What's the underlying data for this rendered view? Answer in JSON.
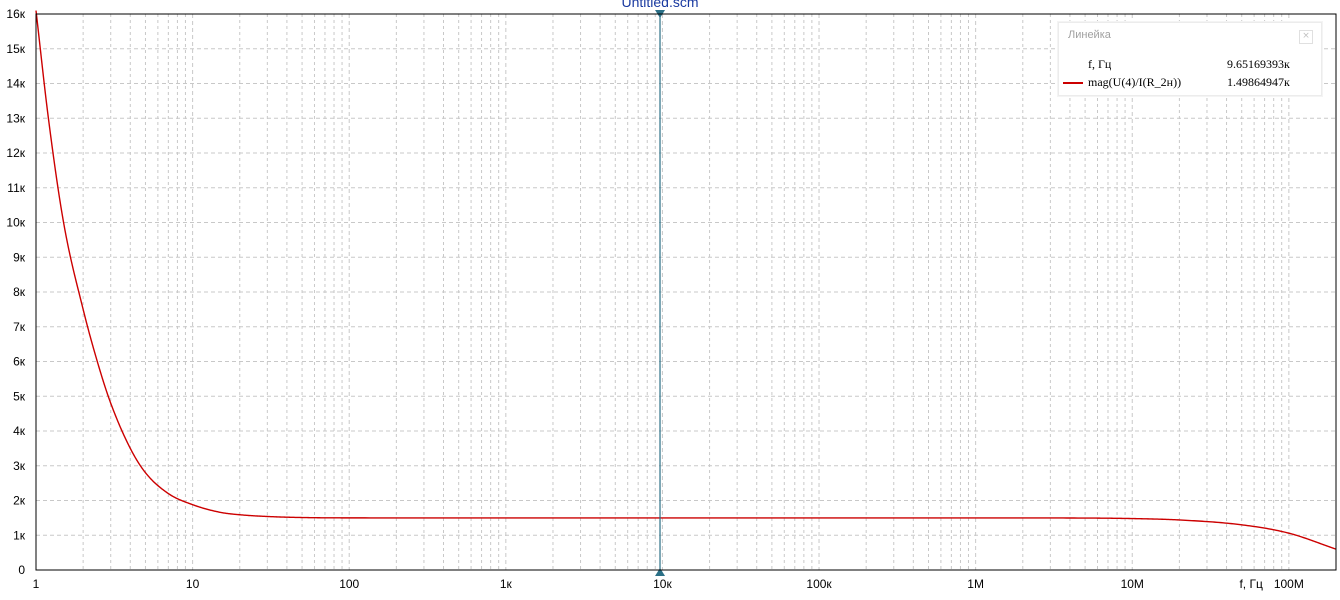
{
  "window": {
    "title": "Untitled.scm"
  },
  "colors": {
    "curve": "#cc0000",
    "cursor": "#2a6f86",
    "grid": "#c8c8c8",
    "title": "#1a3aa0"
  },
  "chart_data": {
    "type": "line",
    "x_scale": "log",
    "xlim": [
      1,
      200000000
    ],
    "ylim": [
      0,
      16000
    ],
    "xlabel": "f, Гц",
    "ylabel": "",
    "grid": true,
    "x_tick_values": [
      1,
      10,
      100,
      1000,
      10000,
      100000,
      1000000,
      10000000,
      100000000
    ],
    "x_tick_labels": [
      "1",
      "10",
      "100",
      "1к",
      "10к",
      "100к",
      "1M",
      "10M",
      "100M"
    ],
    "y_tick_values": [
      0,
      1000,
      2000,
      3000,
      4000,
      5000,
      6000,
      7000,
      8000,
      9000,
      10000,
      11000,
      12000,
      13000,
      14000,
      15000,
      16000
    ],
    "y_tick_labels": [
      "0",
      "1к",
      "2к",
      "3к",
      "4к",
      "5к",
      "6к",
      "7к",
      "8к",
      "9к",
      "10к",
      "11к",
      "12к",
      "13к",
      "14к",
      "15к",
      "16к"
    ],
    "series": [
      {
        "name": "mag(U(4)/I(R_2н))",
        "x": [
          1,
          1.2,
          1.5,
          2,
          2.5,
          3,
          4,
          5,
          7,
          10,
          15,
          20,
          30,
          50,
          100,
          1000,
          10000,
          100000,
          1000000,
          5000000,
          10000000,
          20000000,
          50000000,
          100000000,
          200000000
        ],
        "y": [
          16100,
          13000,
          10000,
          7500,
          5900,
          4800,
          3500,
          2800,
          2200,
          1880,
          1660,
          1590,
          1540,
          1510,
          1500,
          1499,
          1499,
          1499,
          1499,
          1495,
          1480,
          1440,
          1300,
          1060,
          600
        ]
      }
    ],
    "cursor": {
      "x": 9651.69393
    }
  },
  "cursor_panel": {
    "title": "Линейка",
    "close_label": "×",
    "x_label": "f, Гц",
    "x_value": "9.65169393к",
    "series_label": "mag(U(4)/I(R_2н))",
    "series_value": "1.49864947к"
  }
}
